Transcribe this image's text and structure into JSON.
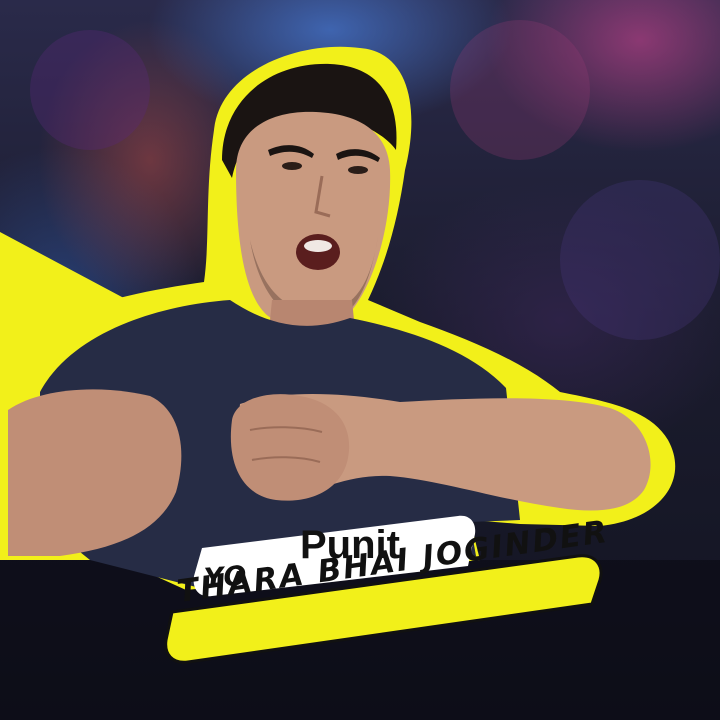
{
  "caption": {
    "name": "Punit",
    "prefix": "YO",
    "tagline": "THARA BHAI JOGINDER"
  },
  "colors": {
    "accent_yellow": "#f2f01a",
    "shirt_navy": "#262c45",
    "skin": "#c99a80",
    "hair": "#1a1412",
    "caption_box": "#ffffff"
  }
}
